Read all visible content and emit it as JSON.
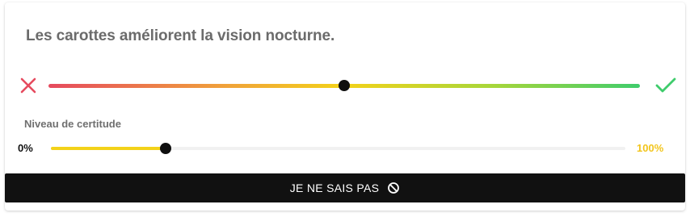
{
  "question": {
    "text": "Les carottes améliorent la vision nocturne."
  },
  "truth_slider": {
    "false_icon": "x-icon",
    "true_icon": "check-icon",
    "value": 0.5,
    "colors": {
      "false": "#e64a5e",
      "middle": "#f3d219",
      "true": "#3fcc6c"
    }
  },
  "certainty": {
    "label": "Niveau de certitude",
    "min_label": "0%",
    "max_label": "100%",
    "value_percent": 20,
    "accent": "#f3d219"
  },
  "dont_know_button": {
    "label": "JE NE SAIS PAS",
    "icon": "ban-icon"
  }
}
